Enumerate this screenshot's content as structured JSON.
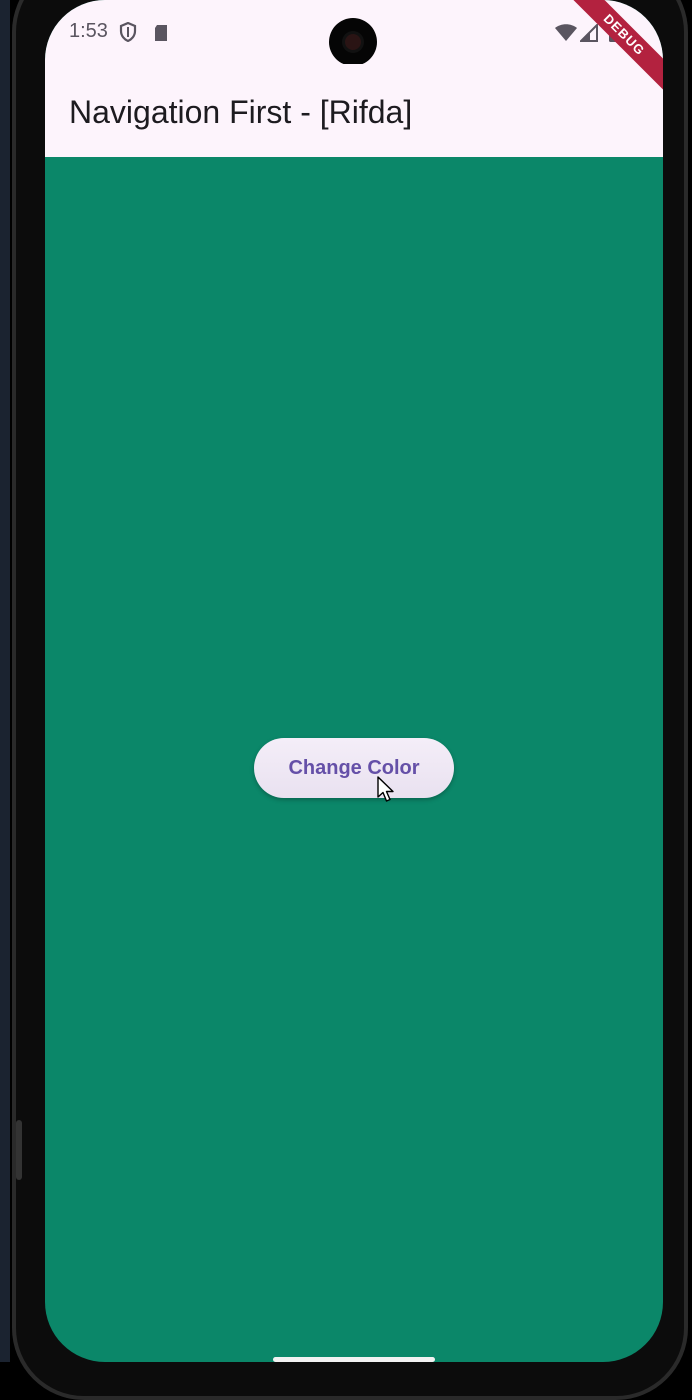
{
  "statusbar": {
    "time": "1:53",
    "icons": [
      "shield-icon",
      "sd-card-icon",
      "wifi-icon",
      "cellular-icon",
      "battery-icon"
    ]
  },
  "appbar": {
    "title": "Navigation First - [Rifda]"
  },
  "debug_banner": {
    "label": "DEBUG"
  },
  "main": {
    "background_color": "#0b8769",
    "button_label": "Change Color"
  },
  "colors": {
    "appbar_bg": "#fdf4fc",
    "button_text": "#6550a8",
    "debug_ribbon": "#b3223f"
  }
}
